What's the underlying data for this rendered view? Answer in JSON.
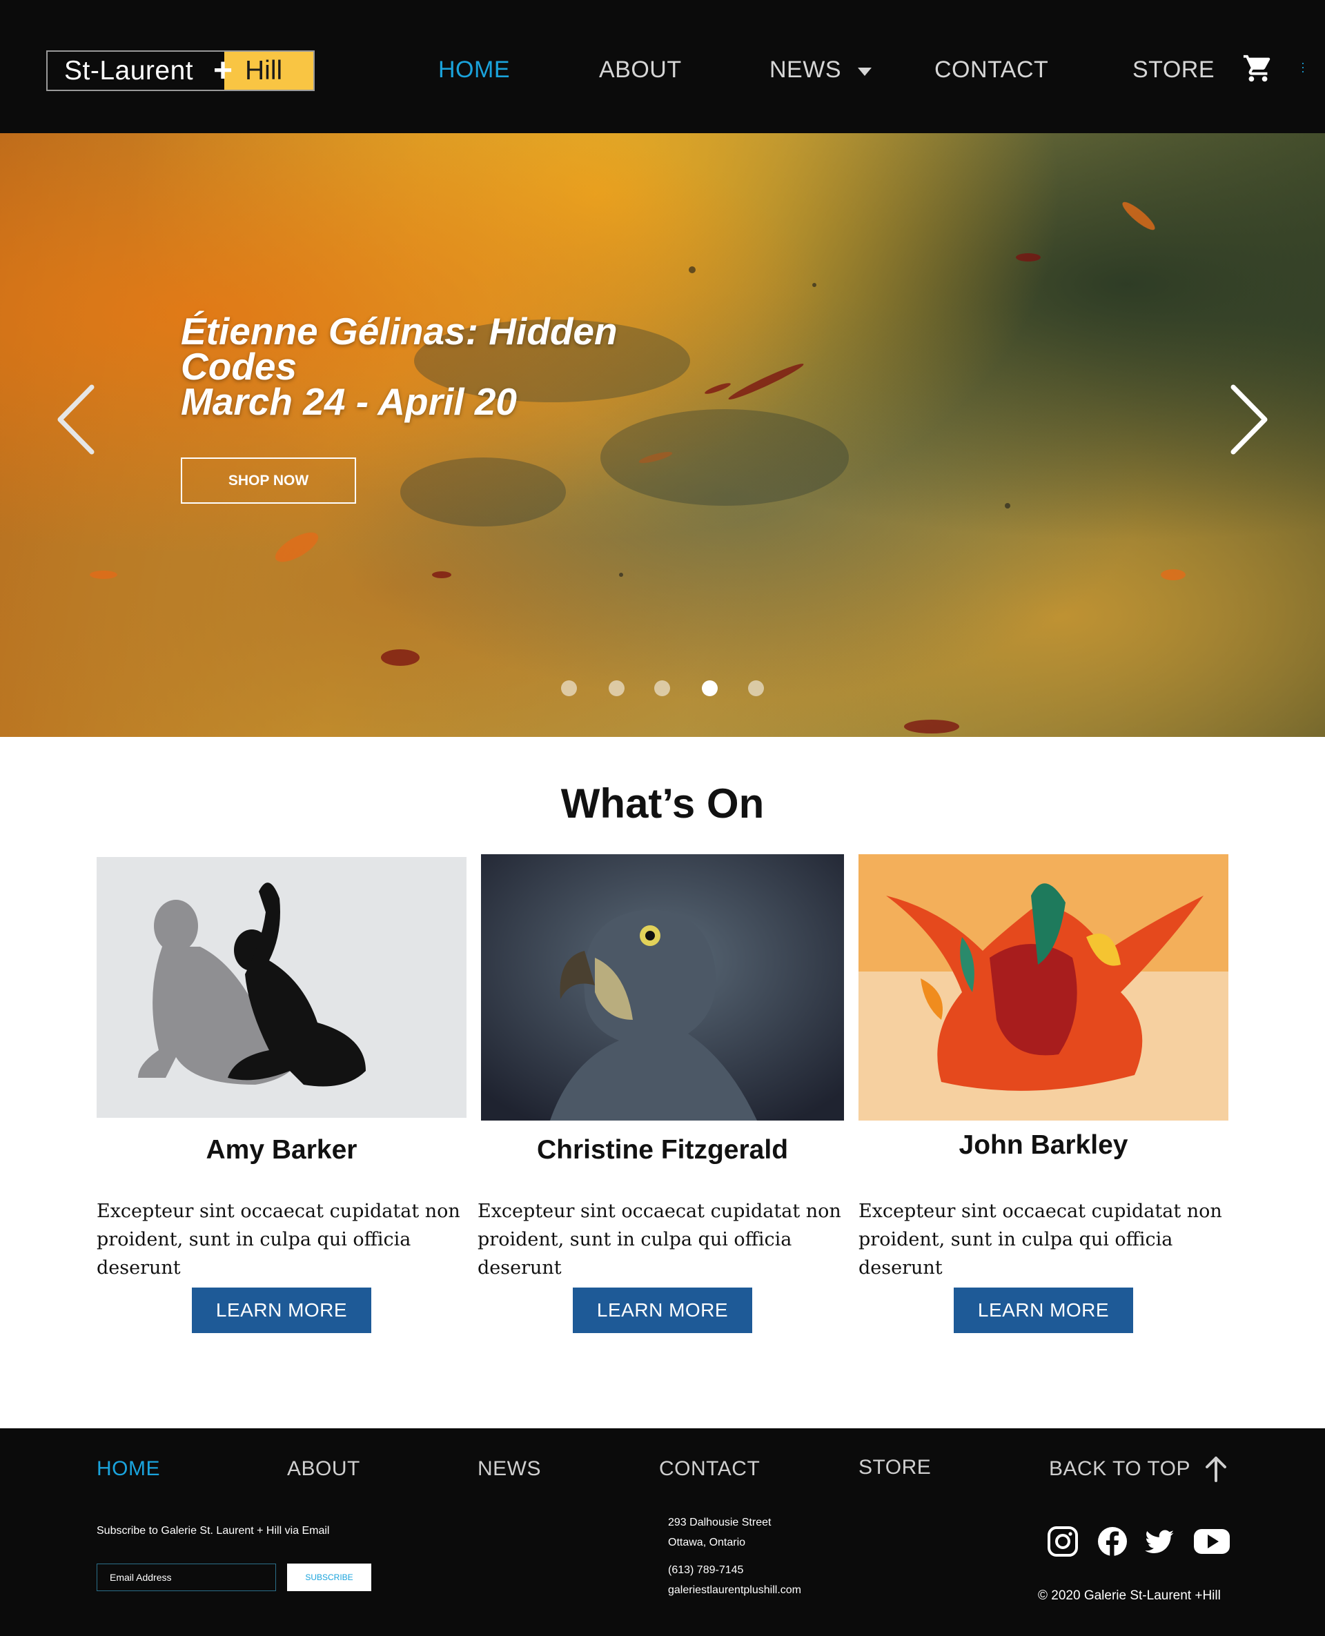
{
  "header": {
    "logo_left": "St-Laurent",
    "logo_plus": "+",
    "logo_right": "Hill",
    "nav": [
      "HOME",
      "ABOUT",
      "NEWS",
      "CONTACT",
      "STORE"
    ],
    "active_nav": "HOME"
  },
  "hero": {
    "title_line1": "Étienne Gélinas: Hidden",
    "title_line2": "Codes",
    "title_line3": "March 24 - April 20",
    "button_label": "SHOP NOW",
    "slide_count": 5,
    "active_slide": 4
  },
  "whats_on": {
    "title": "What’s On",
    "cards": [
      {
        "name": "Amy Barker",
        "text_line1": "Excepteur sint occaecat cupidatat non",
        "text_line2": "proident, sunt in culpa qui officia deserunt",
        "button": "LEARN MORE"
      },
      {
        "name": "Christine Fitzgerald",
        "text_line1": "Excepteur sint occaecat cupidatat non",
        "text_line2": "proident, sunt in culpa qui officia deserunt",
        "button": "LEARN MORE"
      },
      {
        "name": "John Barkley",
        "text_line1": "Excepteur sint occaecat cupidatat non",
        "text_line2": "proident, sunt in culpa qui officia deserunt",
        "button": "LEARN MORE"
      }
    ]
  },
  "footer": {
    "nav": [
      "HOME",
      "ABOUT",
      "NEWS",
      "CONTACT",
      "STORE"
    ],
    "back_to_top": "BACK TO TOP",
    "subscribe_label": "Subscribe to Galerie St. Laurent + Hill via Email",
    "email_placeholder": "Email Address",
    "subscribe_button": "SUBSCRIBE",
    "address_line1": "293 Dalhousie Street",
    "address_line2": "Ottawa, Ontario",
    "phone": "(613) 789-7145",
    "website": "galeriestlaurentplushill.com",
    "copyright": "© 2020 Galerie St-Laurent +Hill",
    "social_icons": [
      "instagram-icon",
      "facebook-icon",
      "twitter-icon",
      "youtube-icon"
    ]
  },
  "colors": {
    "accent": "#1aa3dc",
    "logo_yellow": "#f9c543",
    "button_blue": "#1e5a97",
    "header_bg": "#0b0b0b"
  }
}
